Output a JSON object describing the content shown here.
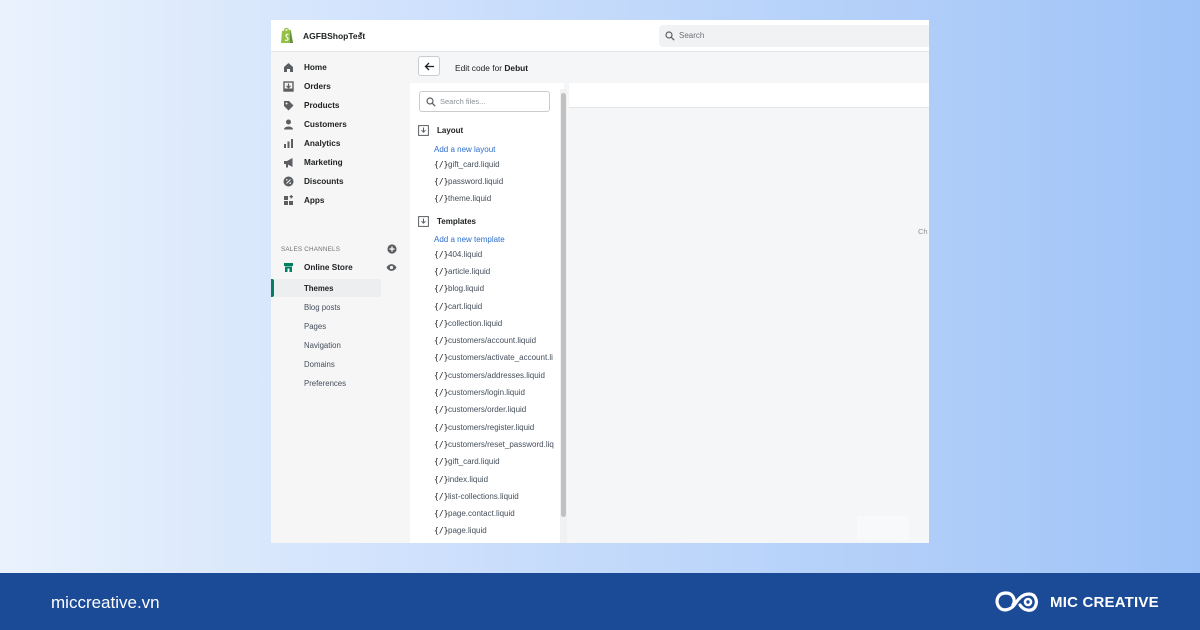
{
  "store": {
    "name": "AGFBShopTest",
    "caret": "▾"
  },
  "search": {
    "placeholder": "Search"
  },
  "nav": {
    "items": [
      {
        "label": "Home",
        "icon": "home-icon"
      },
      {
        "label": "Orders",
        "icon": "orders-icon"
      },
      {
        "label": "Products",
        "icon": "products-icon"
      },
      {
        "label": "Customers",
        "icon": "customers-icon"
      },
      {
        "label": "Analytics",
        "icon": "analytics-icon"
      },
      {
        "label": "Marketing",
        "icon": "marketing-icon"
      },
      {
        "label": "Discounts",
        "icon": "discounts-icon"
      },
      {
        "label": "Apps",
        "icon": "apps-icon"
      }
    ],
    "sales_channels_label": "SALES CHANNELS",
    "online_store": "Online Store",
    "sub_items": [
      "Themes",
      "Blog posts",
      "Pages",
      "Navigation",
      "Domains",
      "Preferences"
    ],
    "active_sub_item": "Themes"
  },
  "header": {
    "prefix": "Edit code for ",
    "theme": "Debut"
  },
  "file_panel": {
    "search_placeholder": "Search files...",
    "layout_label": "Layout",
    "add_layout": "Add a new layout",
    "layout_files": [
      "gift_card.liquid",
      "password.liquid",
      "theme.liquid"
    ],
    "templates_label": "Templates",
    "add_template": "Add a new template",
    "template_files": [
      "404.liquid",
      "article.liquid",
      "blog.liquid",
      "cart.liquid",
      "collection.liquid",
      "customers/account.liquid",
      "customers/activate_account.li",
      "customers/addresses.liquid",
      "customers/login.liquid",
      "customers/order.liquid",
      "customers/register.liquid",
      "customers/reset_password.liq",
      "gift_card.liquid",
      "index.liquid",
      "list-collections.liquid",
      "page.contact.liquid",
      "page.liquid"
    ],
    "file_glyph": "{/}"
  },
  "editor": {
    "hint": "Ch"
  },
  "footer": {
    "site": "miccreative.vn",
    "brand": "MIC CREATIVE"
  },
  "colors": {
    "accent": "#008060",
    "link": "#2c6ecb",
    "footer": "#1b4a97"
  }
}
